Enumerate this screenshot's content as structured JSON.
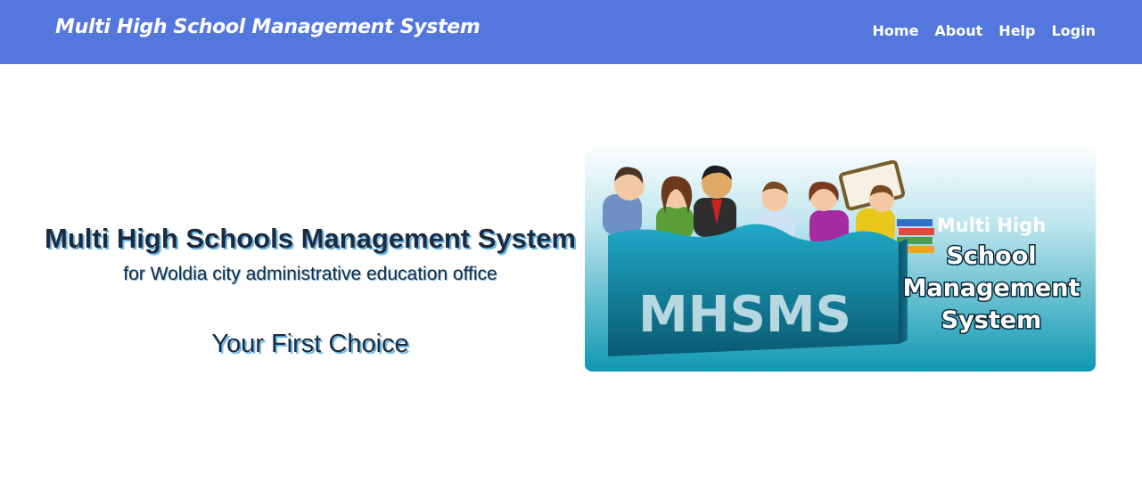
{
  "navbar": {
    "brand": "Multi High School Management System",
    "links": [
      {
        "label": "Home"
      },
      {
        "label": "About"
      },
      {
        "label": "Help"
      },
      {
        "label": "Login"
      }
    ],
    "color": "#5477dd"
  },
  "hero": {
    "title": "Multi High Schools Management System",
    "subtitle": "for Woldia city administrative education office",
    "tagline": "Your First Choice"
  },
  "banner": {
    "acronym": "MHSMS",
    "line1": "Multi High",
    "line2": "School",
    "line3": "Management",
    "line4": "System"
  }
}
